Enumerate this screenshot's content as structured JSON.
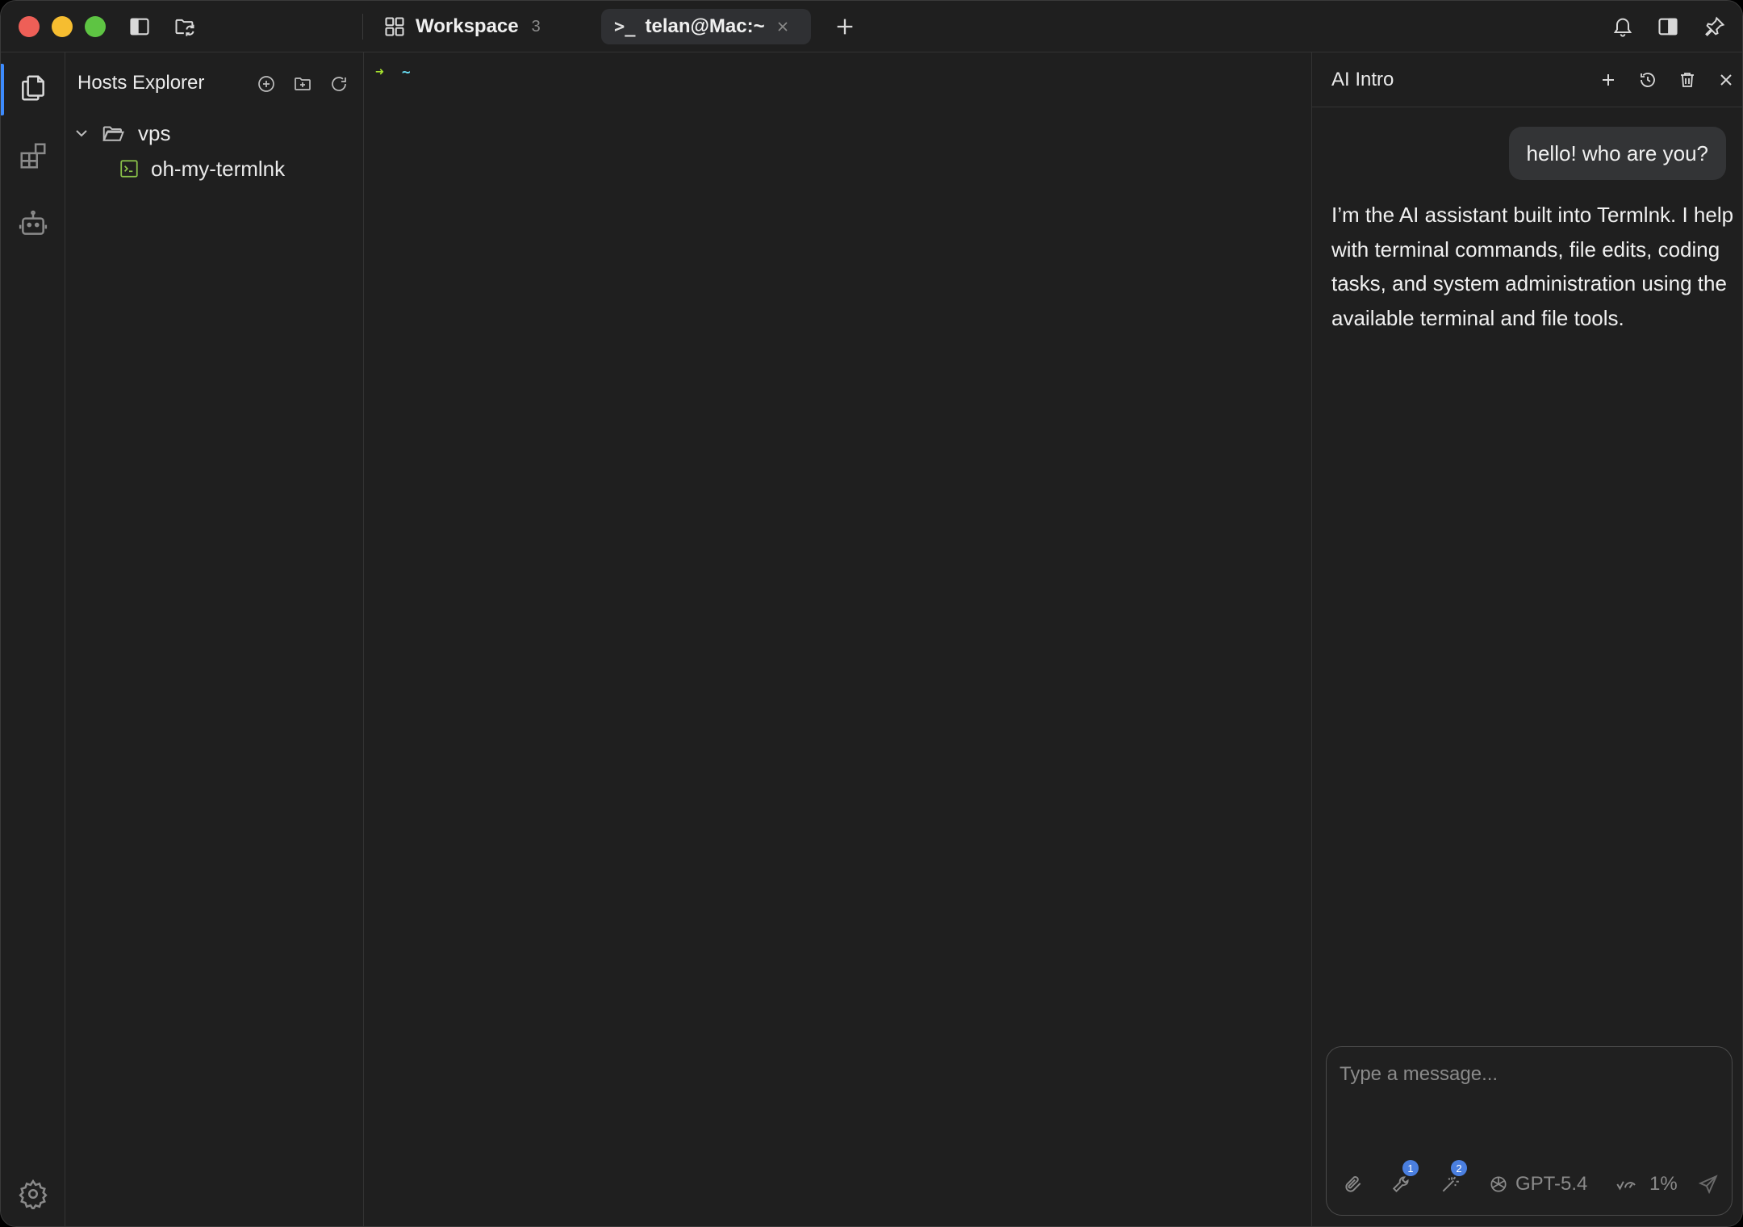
{
  "titlebar": {
    "workspace_tab": {
      "label": "Workspace",
      "count": "3"
    },
    "terminal_tab": {
      "label": "telan@Mac:~",
      "prompt_glyph": ">_"
    }
  },
  "explorer": {
    "title": "Hosts Explorer",
    "tree": [
      {
        "type": "folder",
        "label": "vps",
        "expanded": true
      },
      {
        "type": "host",
        "label": "oh-my-termlnk"
      }
    ]
  },
  "terminal": {
    "prompt_arrow": "➜",
    "cwd": "~"
  },
  "ai": {
    "title": "AI Intro",
    "messages": [
      {
        "role": "user",
        "text": "hello! who are you?"
      },
      {
        "role": "assistant",
        "text": "I’m the AI assistant built into Termlnk. I help with terminal commands, file edits, coding tasks, and system administration using the available terminal and file tools."
      }
    ],
    "composer": {
      "placeholder": "Type a message...",
      "tools_badge": "1",
      "skills_badge": "2",
      "model": "GPT-5.4",
      "context_usage": "1%"
    }
  },
  "colors": {
    "accent": "#3d8bfd",
    "prompt_arrow": "#a6e22e",
    "prompt_cwd": "#66d9ef",
    "host_icon": "#8bc34a"
  }
}
